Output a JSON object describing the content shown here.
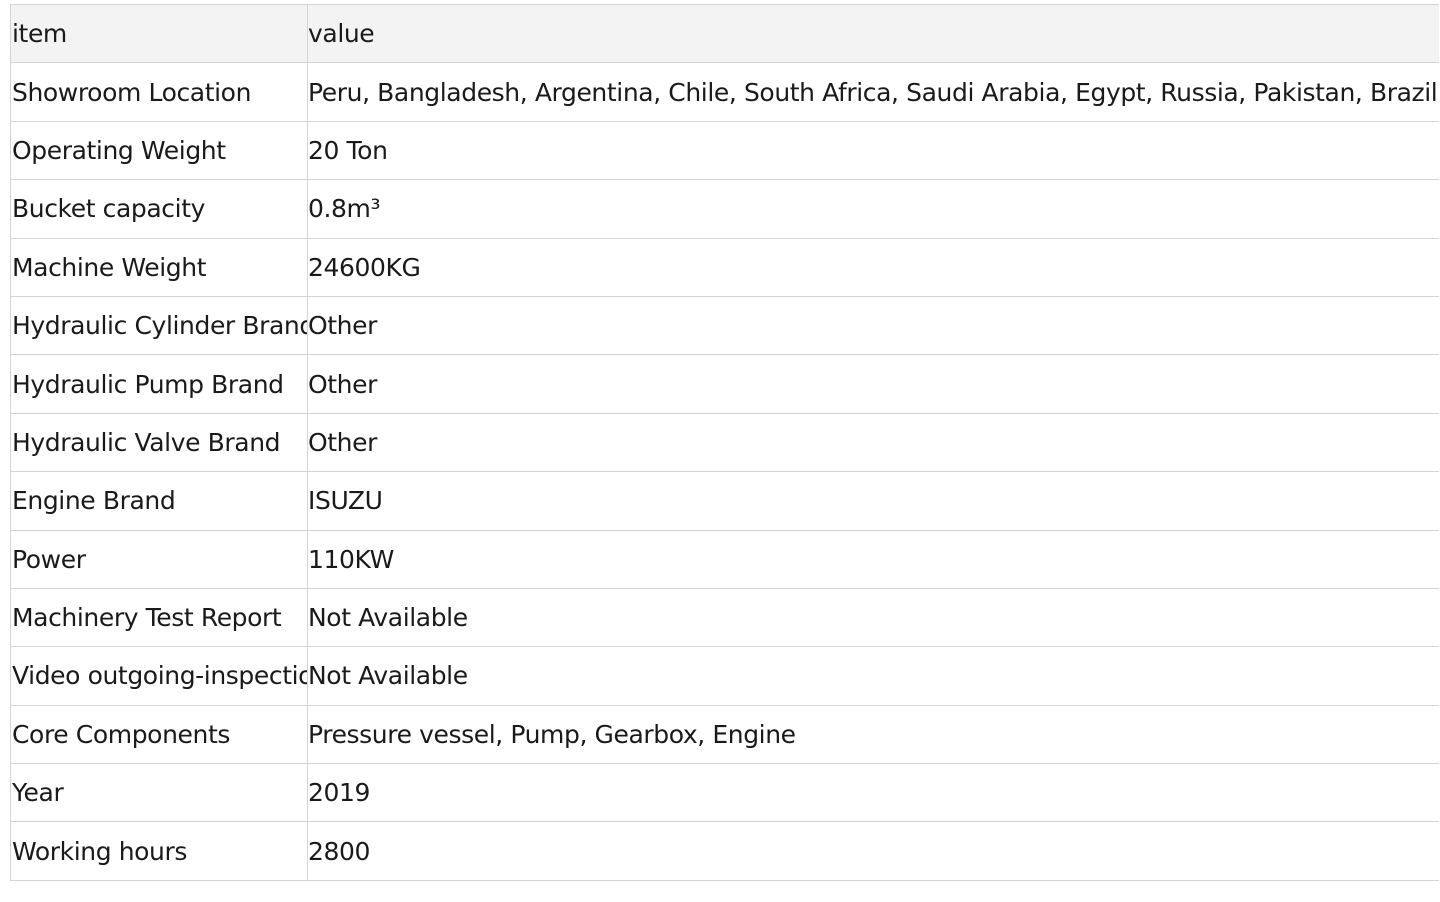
{
  "table": {
    "header": {
      "key": "item",
      "value": "value"
    },
    "rows": [
      {
        "key": "Showroom Location",
        "value": "Peru, Bangladesh, Argentina, Chile, South Africa, Saudi Arabia, Egypt, Russia, Pakistan, Brazil, UAE"
      },
      {
        "key": "Operating Weight",
        "value": "20 Ton"
      },
      {
        "key": "Bucket capacity",
        "value": "0.8m³"
      },
      {
        "key": "Machine Weight",
        "value": "24600KG"
      },
      {
        "key": "Hydraulic Cylinder Brand",
        "value": "Other"
      },
      {
        "key": "Hydraulic Pump Brand",
        "value": "Other"
      },
      {
        "key": "Hydraulic Valve Brand",
        "value": "Other"
      },
      {
        "key": "Engine Brand",
        "value": "ISUZU"
      },
      {
        "key": "Power",
        "value": "110KW"
      },
      {
        "key": "Machinery Test Report",
        "value": "Not Available"
      },
      {
        "key": "Video outgoing-inspection",
        "value": "Not Available"
      },
      {
        "key": "Core Components",
        "value": "Pressure vessel, Pump, Gearbox, Engine"
      },
      {
        "key": "Year",
        "value": "2019"
      },
      {
        "key": "Working hours",
        "value": "2800"
      }
    ]
  }
}
